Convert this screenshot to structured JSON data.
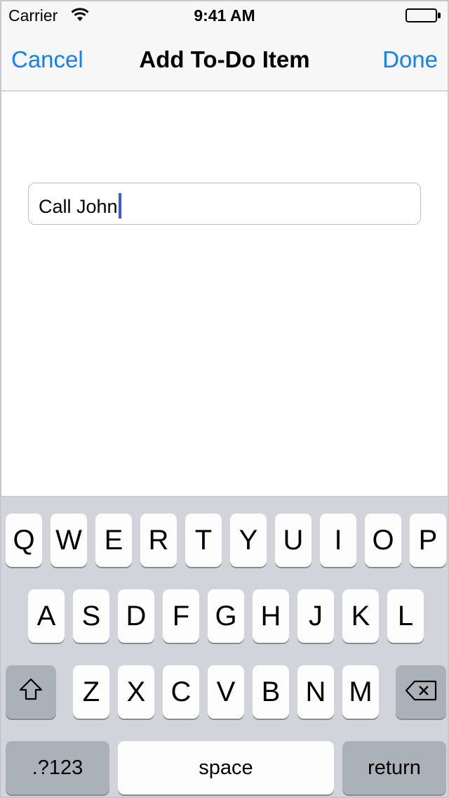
{
  "status_bar": {
    "carrier": "Carrier",
    "time": "9:41 AM"
  },
  "nav_bar": {
    "left_button": "Cancel",
    "title": "Add To-Do Item",
    "right_button": "Done"
  },
  "text_field": {
    "value": "Call John"
  },
  "keyboard": {
    "row1": [
      "Q",
      "W",
      "E",
      "R",
      "T",
      "Y",
      "U",
      "I",
      "O",
      "P"
    ],
    "row2": [
      "A",
      "S",
      "D",
      "F",
      "G",
      "H",
      "J",
      "K",
      "L"
    ],
    "row3": [
      "Z",
      "X",
      "C",
      "V",
      "B",
      "N",
      "M"
    ],
    "numbers_key": ".?123",
    "space_key": "space",
    "return_key": "return"
  },
  "colors": {
    "accent": "#157efb",
    "caret": "#3b5ae0",
    "keyboard_bg": "#d1d5db"
  }
}
